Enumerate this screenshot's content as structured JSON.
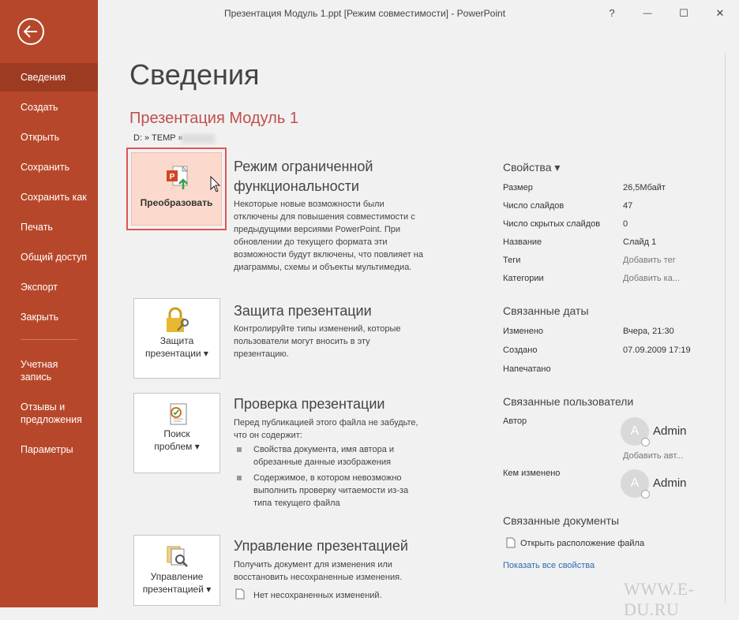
{
  "window": {
    "title": "Презентация Модуль 1.ppt [Режим совместимости]  -  PowerPoint",
    "help": "?",
    "minimize": "—",
    "maximize": "☐",
    "close": "✕"
  },
  "sidebar": {
    "items": [
      {
        "label": "Сведения",
        "active": true
      },
      {
        "label": "Создать"
      },
      {
        "label": "Открыть"
      },
      {
        "label": "Сохранить"
      },
      {
        "label": "Сохранить как"
      },
      {
        "label": "Печать"
      },
      {
        "label": "Общий доступ"
      },
      {
        "label": "Экспорт"
      },
      {
        "label": "Закрыть"
      },
      {
        "label_line1": "Учетная",
        "label_line2": "запись"
      },
      {
        "label_line1": "Отзывы и",
        "label_line2": "предложения"
      },
      {
        "label": "Параметры"
      }
    ],
    "color": "#b7472a"
  },
  "main": {
    "heading": "Сведения",
    "doc_title": "Презентация Модуль 1",
    "doc_path": "D: » TEMP »",
    "sections": {
      "compat": {
        "button": "Преобразовать",
        "title_line1": "Режим ограниченной",
        "title_line2": "функциональности",
        "desc": [
          "Некоторые новые возможности были",
          "отключены для повышения совместимости с",
          "предыдущими версиями PowerPoint. При",
          "обновлении до текущего формата эти",
          "возможности будут включены, что повлияет на",
          "диаграммы, схемы и объекты мультимедиа."
        ]
      },
      "protect": {
        "button_line1": "Защита",
        "button_line2": "презентации ▾",
        "title": "Защита презентации",
        "desc": [
          "Контролируйте типы изменений, которые",
          "пользователи могут вносить в эту",
          "презентацию."
        ]
      },
      "inspect": {
        "button_line1": "Поиск",
        "button_line2": "проблем ▾",
        "title": "Проверка презентации",
        "desc": [
          "Перед публикацией этого файла не забудьте,",
          "что он содержит:"
        ],
        "bullets": [
          [
            "Свойства документа, имя автора и",
            "обрезанные данные изображения"
          ],
          [
            "Содержимое, в котором невозможно",
            "выполнить проверку читаемости из-за",
            "типа текущего файла"
          ]
        ]
      },
      "manage": {
        "button_line1": "Управление",
        "button_line2": "презентацией ▾",
        "title": "Управление презентацией",
        "desc": [
          "Получить документ для изменения или",
          "восстановить несохраненные изменения."
        ],
        "note": "Нет несохраненных изменений."
      }
    }
  },
  "properties": {
    "heading": "Свойства ▾",
    "rows": [
      {
        "label": "Размер",
        "value": "26,5Мбайт"
      },
      {
        "label": "Число слайдов",
        "value": "47"
      },
      {
        "label": "Число скрытых слайдов",
        "value": "0"
      },
      {
        "label": "Название",
        "value": "Слайд 1"
      },
      {
        "label": "Теги",
        "value": "Добавить тег"
      },
      {
        "label": "Категории",
        "value": "Добавить ка..."
      }
    ],
    "dates_heading": "Связанные даты",
    "dates": [
      {
        "label": "Изменено",
        "value": "Вчера, 21:30"
      },
      {
        "label": "Создано",
        "value": "07.09.2009 17:19"
      },
      {
        "label": "Напечатано",
        "value": ""
      }
    ],
    "users_heading": "Связанные пользователи",
    "author_label": "Автор",
    "author_initial": "A",
    "author_name": "Admin",
    "add_author": "Добавить авт...",
    "modified_by_label": "Кем изменено",
    "modifier_initial": "A",
    "modifier_name": "Admin",
    "docs_heading": "Связанные документы",
    "open_location": "Открыть расположение файла",
    "show_all": "Показать все свойства"
  },
  "watermark": "WWW.E-DU.RU",
  "colors": {
    "accent": "#b7472a",
    "link": "#2b6cb0",
    "doc_title": "#c0504d",
    "convert_bg": "#fbd9cd",
    "highlight": "#e05555"
  }
}
